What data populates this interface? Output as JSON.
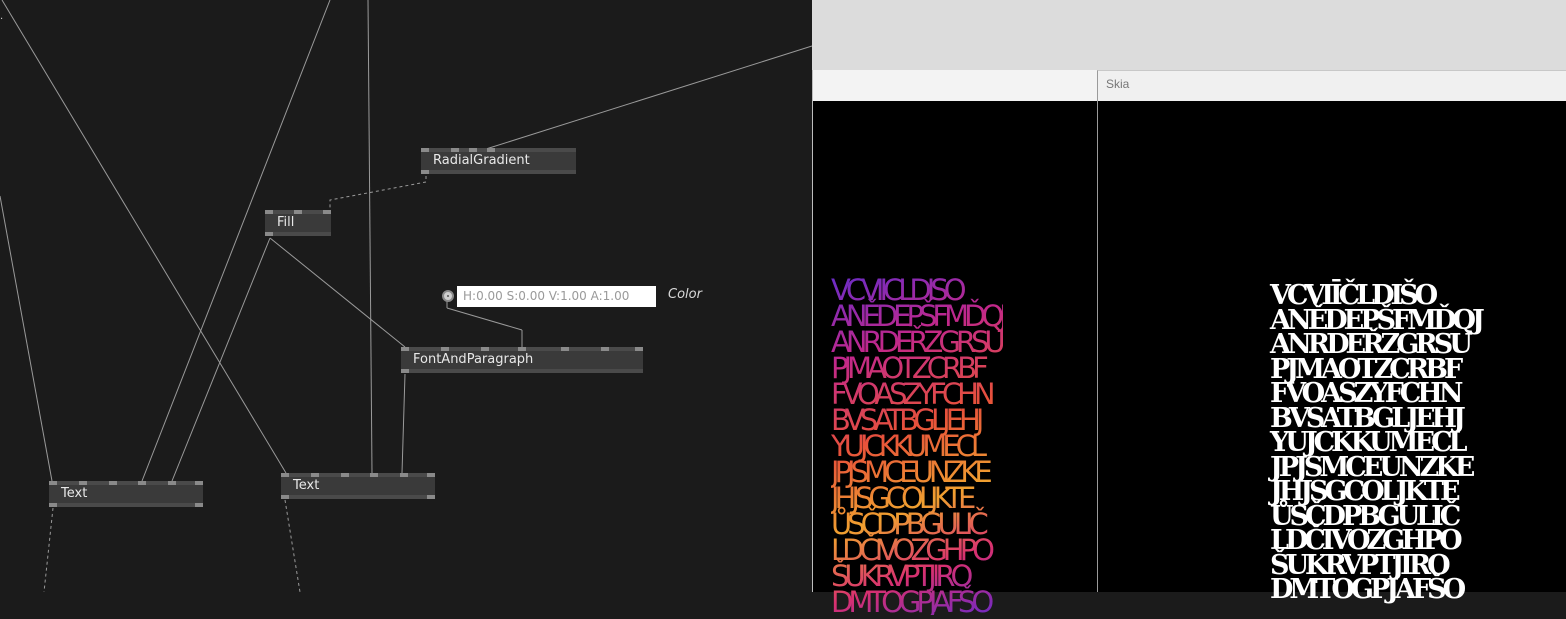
{
  "patch": {
    "nodes": {
      "radial_gradient": "RadialGradient",
      "fill": "Fill",
      "font_and_paragraph": "FontAndParagraph",
      "text_left": "Text",
      "text_right": "Text"
    },
    "color_io": {
      "value": "H:0.00 S:0.00 V:1.00 A:1.00",
      "label": "Color"
    }
  },
  "renderer_windows": {
    "skia_title": "Skia",
    "text_rows": [
      "VCVIĪČLDIŠO",
      "ANĚDEPŠFMĎQJ",
      "ANRDEŘZGRSU",
      "PJMAOTZCRBF",
      "FVOASZYFCHN",
      "BVSATBGLJEHJ",
      "YUJCKKUMECL",
      "JPJSMCEUNZKE",
      "JHJSGCOLJKTE",
      "ŮSČDPBGULIČ",
      "LDČIVOZGHPO",
      "ŠUKRVPTJIRO",
      "DMTOGPJAFŠO"
    ]
  }
}
